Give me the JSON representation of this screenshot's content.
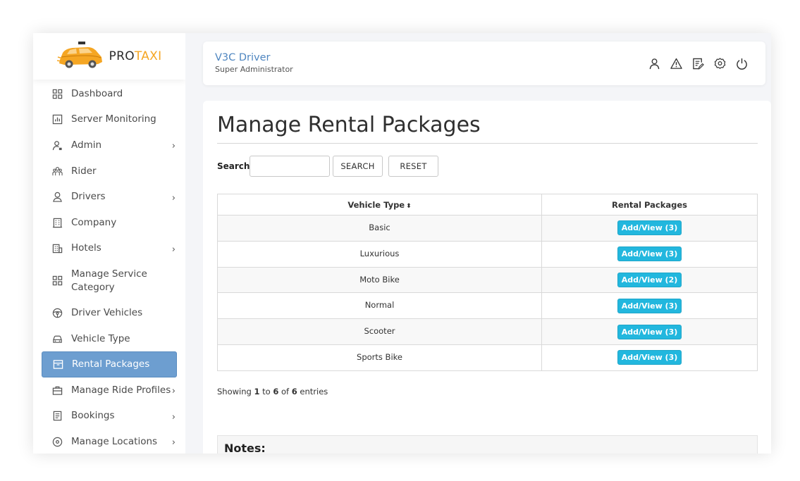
{
  "brand": {
    "pro": "PRO",
    "taxi": "TAXI"
  },
  "sidebar": {
    "items": [
      {
        "label": "Dashboard",
        "icon": "dashboard-icon"
      },
      {
        "label": "Server Monitoring",
        "icon": "chart-icon"
      },
      {
        "label": "Admin",
        "icon": "admin-icon",
        "has_submenu": true
      },
      {
        "label": "Rider",
        "icon": "rider-icon"
      },
      {
        "label": "Drivers",
        "icon": "driver-icon",
        "has_submenu": true
      },
      {
        "label": "Company",
        "icon": "company-icon"
      },
      {
        "label": "Hotels",
        "icon": "hotel-icon",
        "has_submenu": true
      },
      {
        "label": "Manage Service Category",
        "icon": "grid-icon"
      },
      {
        "label": "Driver Vehicles",
        "icon": "steering-wheel-icon"
      },
      {
        "label": "Vehicle Type",
        "icon": "car-icon"
      },
      {
        "label": "Rental Packages",
        "icon": "package-icon",
        "active": true
      },
      {
        "label": "Manage Ride Profiles",
        "icon": "briefcase-icon",
        "has_submenu": true
      },
      {
        "label": "Bookings",
        "icon": "bookings-icon",
        "has_submenu": true
      },
      {
        "label": "Manage Locations",
        "icon": "location-icon",
        "has_submenu": true
      }
    ],
    "chevron": "›"
  },
  "header": {
    "user_name": "V3C Driver",
    "user_role": "Super Administrator",
    "icons": [
      "user-icon",
      "warning-icon",
      "edit-icon",
      "settings-icon",
      "power-icon"
    ]
  },
  "main": {
    "title": "Manage Rental Packages",
    "search_label": "Search:",
    "search_value": "",
    "search_button": "SEARCH",
    "reset_button": "RESET",
    "table": {
      "headers": [
        "Vehicle Type",
        "Rental Packages"
      ],
      "sort_glyph": "⬍",
      "rows": [
        {
          "vehicle": "Basic",
          "packages": "Add/View (3)"
        },
        {
          "vehicle": "Luxurious",
          "packages": "Add/View (3)"
        },
        {
          "vehicle": "Moto Bike",
          "packages": "Add/View (2)"
        },
        {
          "vehicle": "Normal",
          "packages": "Add/View (3)"
        },
        {
          "vehicle": "Scooter",
          "packages": "Add/View (3)"
        },
        {
          "vehicle": "Sports Bike",
          "packages": "Add/View (3)"
        }
      ]
    },
    "showing": {
      "prefix": "Showing ",
      "from": "1",
      "to_word": " to ",
      "to": "6",
      "of_word": " of ",
      "total": "6",
      "suffix": " entries"
    },
    "notes_title": "Notes:"
  },
  "colors": {
    "accent_blue": "#6d9ed0",
    "button_cyan": "#22b7de",
    "brand_orange": "#f5a623",
    "user_name_blue": "#4f86c0"
  }
}
